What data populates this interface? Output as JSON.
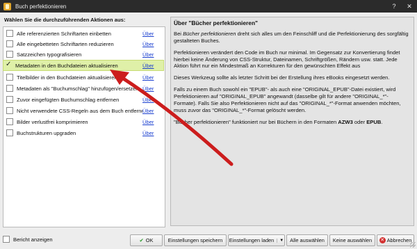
{
  "window": {
    "title": "Buch perfektionieren",
    "help_label": "?",
    "close_label": "✕"
  },
  "actions_heading": "Wählen Sie die durchzuführenden Aktionen aus:",
  "actions": [
    {
      "label": "Alle referenzierten Schriftarten einbetten",
      "checked": false,
      "selected": false,
      "about": "Über"
    },
    {
      "label": "Alle eingebetteten Schriftarten reduzieren",
      "checked": false,
      "selected": false,
      "about": "Über"
    },
    {
      "label": "Satzzeichen typografisieren",
      "checked": false,
      "selected": false,
      "about": "Über"
    },
    {
      "label": "Metadaten in den Buchdateien aktualisieren",
      "checked": true,
      "selected": true,
      "about": "Über"
    },
    {
      "label": "Titelbilder in den Buchdateien aktualisieren",
      "checked": false,
      "selected": false,
      "about": "Über"
    },
    {
      "label": "Metadaten als \"Buchumschlag\" hinzufügen/ersetzen",
      "checked": false,
      "selected": false,
      "about": "Über"
    },
    {
      "label": "Zuvor eingefügten Buchumschlag entfernen",
      "checked": false,
      "selected": false,
      "about": "Über"
    },
    {
      "label": "Nicht verwendete CSS-Regeln aus dem Buch entfernen",
      "checked": false,
      "selected": false,
      "about": "Über"
    },
    {
      "label": "Bilder verlustfrei komprimieren",
      "checked": false,
      "selected": false,
      "about": "Über"
    },
    {
      "label": "Buchstrukturen upgraden",
      "checked": false,
      "selected": false,
      "about": "Über"
    }
  ],
  "info": {
    "title": "Über \"Bücher perfektionieren\"",
    "p1_a": "Bei ",
    "p1_em": "Bücher perfektionieren",
    "p1_b": " dreht sich alles um den Feinschliff und die Perfektionierung des sorgfältig gestalteten Buches.",
    "p2": "Perfektionieren verändert den Code im Buch nur minimal. Im Gegensatz zur Konvertierung findet hierbei keine Änderung von CSS-Struktur, Dateinamen, Schriftgrößen, Rändern usw. statt. Jede Aktion führt nur ein Mindestmaß an Korrekturen für den gewünschten Effekt aus",
    "p3": "Dieses Werkzeug sollte als letzter Schritt bei der Erstellung ihres eBooks eingesetzt werden.",
    "p4": "Falls zu einem Buch sowohl ein \"EPUB\"- als auch eine \"ORIGINAL_EPUB\"-Datei existiert, wird Perfektionieren auf \"ORIGINAL_EPUB\" angewandt (dasselbe gilt für andere \"ORIGINAL_*\"-Formate). Falls Sie also Perfektionieren nicht auf das \"ORIGINAL_*\"-Format anwenden möchten, muss zuvor das \"ORIGINAL_*\"-Format gelöscht werden.",
    "p5_a": "\"Bücher perfektionieren\" funktioniert nur bei Büchern in den Formaten ",
    "p5_fmt1": "AZW3",
    "p5_mid": " oder ",
    "p5_fmt2": "EPUB",
    "p5_end": "."
  },
  "bottom": {
    "show_report": "Bericht anzeigen",
    "ok": "OK",
    "save_settings": "Einstellungen speichern",
    "load_settings": "Einstellungen laden",
    "select_all": "Alle auswählen",
    "select_none": "Keine auswählen",
    "cancel": "Abbrechen"
  },
  "colors": {
    "annotation_arrow": "#cc1d1d",
    "selected_row": "#dff0a8",
    "link": "#1a3fd0"
  }
}
